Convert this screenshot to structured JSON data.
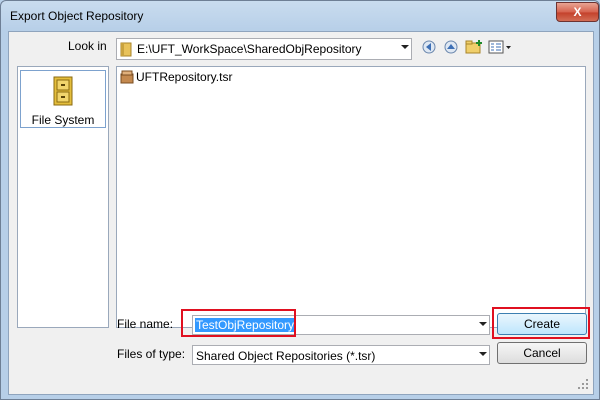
{
  "window": {
    "title": "Export Object Repository",
    "close_glyph": "X"
  },
  "toolbar": {
    "look_in_label": "Look in",
    "look_in_path": "E:\\UFT_WorkSpace\\SharedObjRepository",
    "icons": [
      "folder-icon",
      "back-icon",
      "up-folder-icon",
      "new-folder-icon",
      "view-menu-icon"
    ]
  },
  "places": {
    "items": [
      {
        "label": "File System",
        "icon": "file-cabinet-icon"
      }
    ]
  },
  "files": [
    {
      "name": "UFTRepository.tsr",
      "icon": "repository-file-icon"
    }
  ],
  "form": {
    "file_name_label": "File name:",
    "file_name_value": "TestObjRepository",
    "files_of_type_label": "Files of type:",
    "files_of_type_value": "Shared Object Repositories (*.tsr)"
  },
  "buttons": {
    "create": "Create",
    "cancel": "Cancel"
  },
  "colors": {
    "highlight": "#e01020",
    "selection": "#3399ff"
  }
}
